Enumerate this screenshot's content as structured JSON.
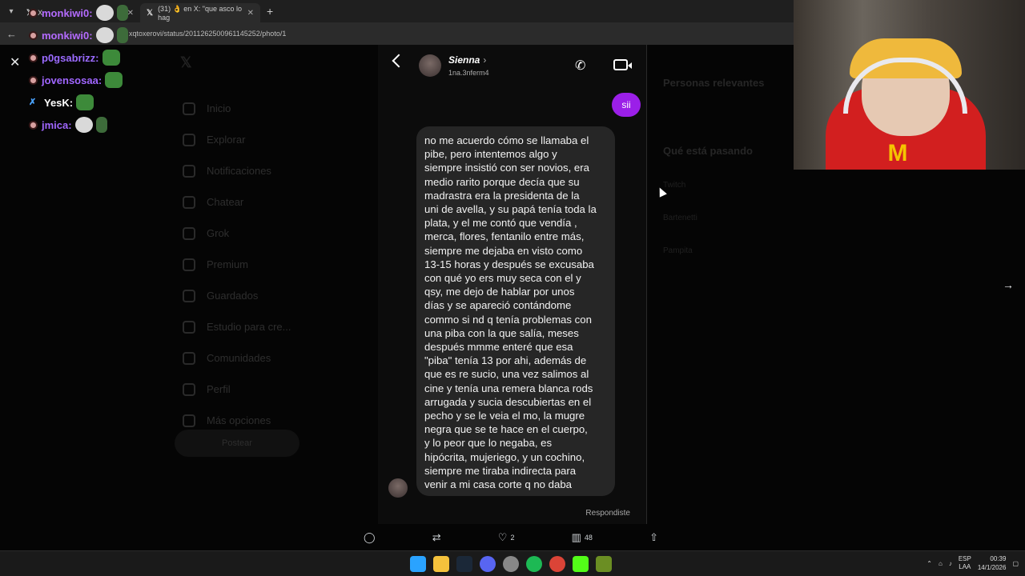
{
  "browser": {
    "tabs": [
      {
        "title": "X",
        "active": false
      },
      {
        "title": "(31) 👌 en X: \"que asco lo hag",
        "active": true
      }
    ],
    "url": "xqtoxerovi/status/2011262500961145252/photo/1"
  },
  "chat": {
    "lines": [
      {
        "user": "monkiwi0:",
        "color": "#b46bff",
        "badge": "face"
      },
      {
        "user": "monkiwi0:",
        "color": "#b46bff",
        "badge": "face"
      },
      {
        "user": "p0gsabrizz:",
        "color": "#9b6bff",
        "badge": "red"
      },
      {
        "user": "jovensosaa:",
        "color": "#a066ff",
        "badge": "red"
      },
      {
        "user": "YesK:",
        "color": "#ffffff",
        "badge": "pin"
      },
      {
        "user": "jmica:",
        "color": "#a066ff",
        "badge": "red"
      }
    ]
  },
  "dm": {
    "name": "Sienna",
    "username": "1na.3nferm4",
    "sent_message": "sii",
    "received_message": "no me acuerdo cómo se llamaba el\npibe, pero intentemos algo y\nsiempre insistió con ser novios, era\nmedio rarito porque decía que su\nmadrastra era la presidenta de la\nuni de avella, y su papá tenía toda la\nplata, y el me contó que vendía ,\nmerca, flores, fentanilo entre más,\nsiempre me dejaba en visto como\n13-15 horas y después se excusaba\ncon qué yo ers muy seca con el y\nqsy, me dejo de hablar por unos\ndías y se apareció contándome\ncommo si nd q tenía problemas con\nuna piba con la que salía, meses\ndespués mmme enteré que esa\n\"piba\" tenía 13 por ahi, además de\nque es re sucio, una vez salimos al\ncine y tenía una remera blanca rods\narrugada  y sucia descubiertas en el\npecho y se le veia el mo, la mugre\nnegra que se te hace en el cuerpo,\ny lo peor que lo negaba, es\nhipócrita, mujeriego, y un cochino,\nsiempre me tiraba indirecta para\nvenir a mi casa corte q no daba",
    "replied_label": "Respondiste"
  },
  "x_nav": {
    "items": [
      "Inicio",
      "Explorar",
      "Notificaciones",
      "Chatear",
      "Grok",
      "Premium",
      "Guardados",
      "Estudio para cre...",
      "Comunidades",
      "Perfil",
      "Más opciones"
    ],
    "post_button": "Postear"
  },
  "right_col": {
    "relevant_title": "Personas relevantes",
    "whats_happening": "Qué está pasando",
    "trends": [
      "Twitch",
      "Bartenetti",
      "Pampita"
    ]
  },
  "post_actions": {
    "likes": "2",
    "views": "48"
  },
  "taskbar": {
    "lang_top": "ESP",
    "lang_bottom": "LAA",
    "time": "00:39",
    "date": "14/1/2026"
  }
}
